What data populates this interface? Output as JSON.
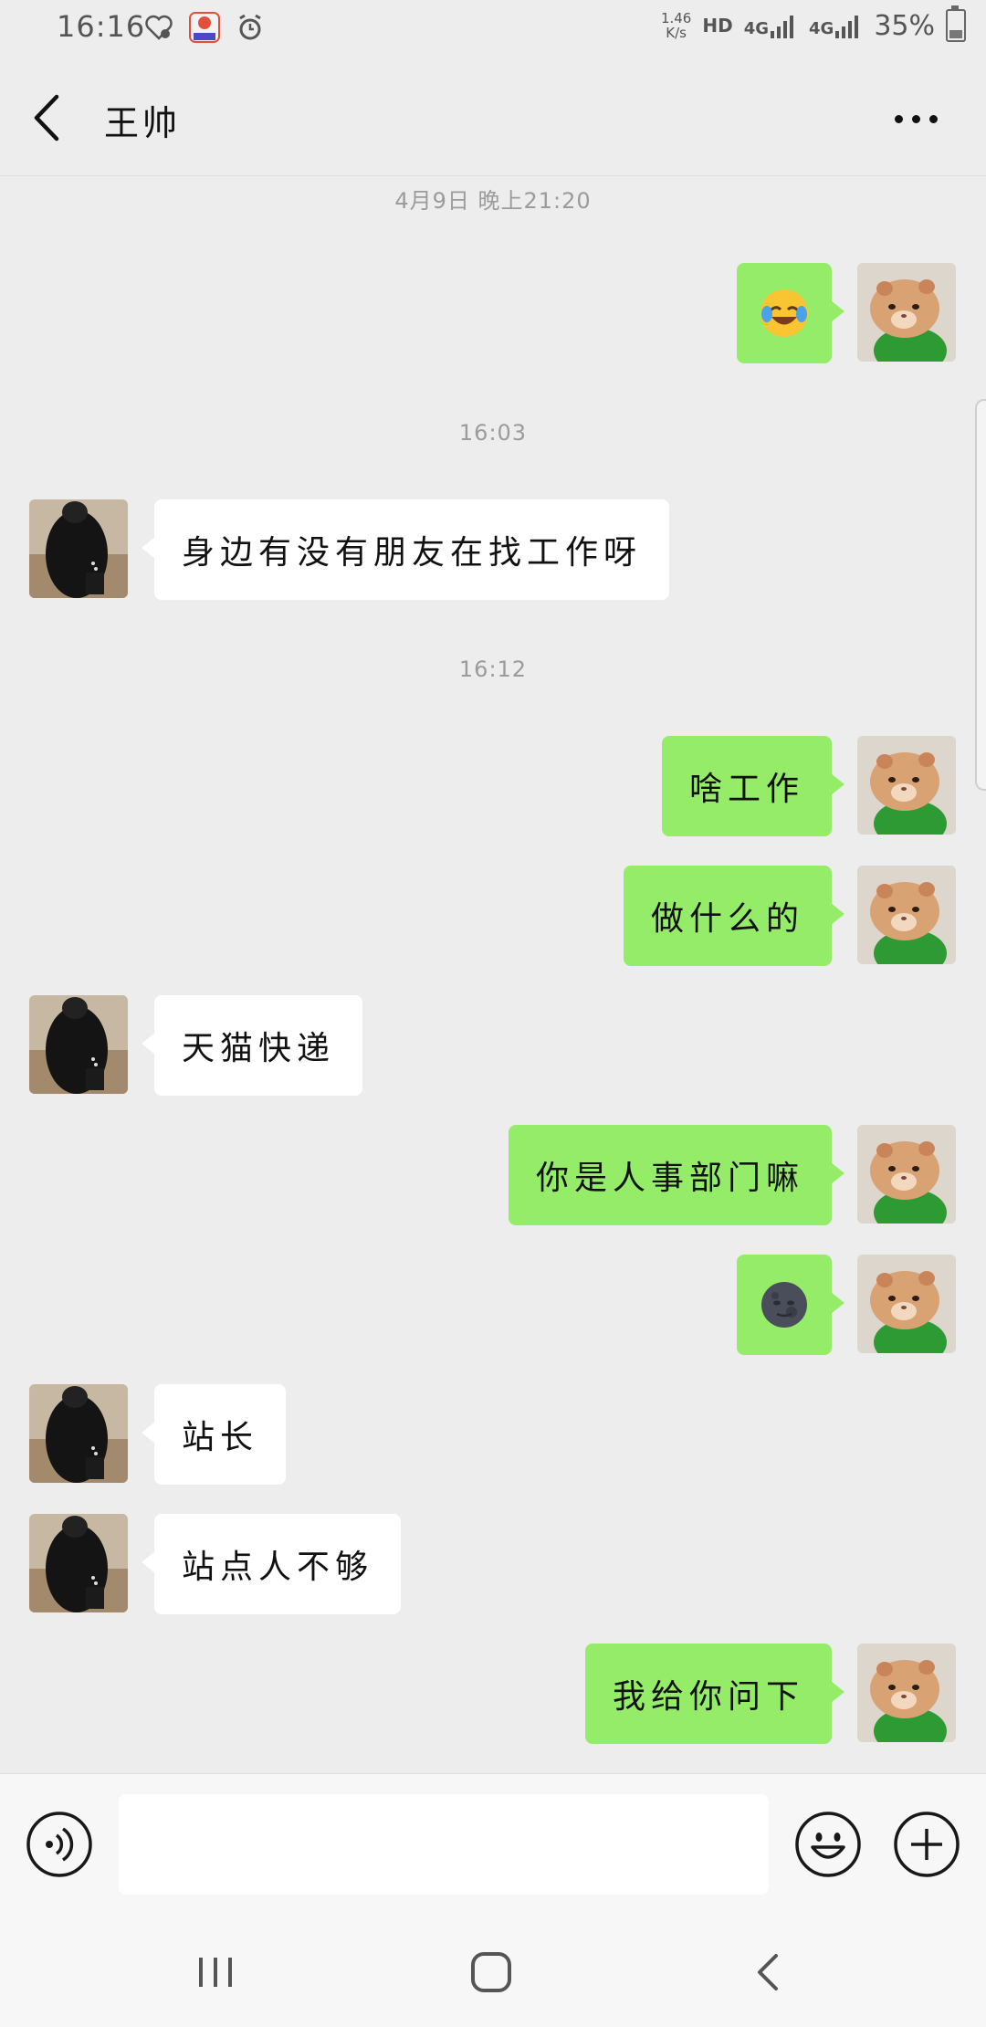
{
  "status_bar": {
    "time": "16:16",
    "net_speed_value": "1.46",
    "net_speed_unit": "K/s",
    "hd": "HD",
    "network_1": "4G",
    "network_2": "4G",
    "battery_percent": "35%",
    "battery_level": 0.35
  },
  "header": {
    "title": "王帅"
  },
  "chat": {
    "timestamps": [
      "4月9日 晚上21:20",
      "16:03",
      "16:12"
    ],
    "messages": [
      {
        "from": "me",
        "type": "emoji",
        "icon": "face-with-tears-of-joy-emoji"
      },
      {
        "from": "contact",
        "type": "text",
        "text": "身边有没有朋友在找工作呀"
      },
      {
        "from": "me",
        "type": "text",
        "text": "啥工作"
      },
      {
        "from": "me",
        "type": "text",
        "text": "做什么的"
      },
      {
        "from": "contact",
        "type": "text",
        "text": "天猫快递"
      },
      {
        "from": "me",
        "type": "text",
        "text": "你是人事部门嘛"
      },
      {
        "from": "me",
        "type": "emoji",
        "icon": "new-moon-face-emoji"
      },
      {
        "from": "contact",
        "type": "text",
        "text": "站长"
      },
      {
        "from": "contact",
        "type": "text",
        "text": "站点人不够"
      },
      {
        "from": "me",
        "type": "text",
        "text": "我给你问下"
      }
    ]
  },
  "input_bar": {
    "text_value": "",
    "icons": [
      "voice-icon",
      "emoji-icon",
      "plus-icon"
    ]
  },
  "nav_bar": {
    "icons": [
      "recent-apps-icon",
      "home-icon",
      "back-icon"
    ]
  },
  "colors": {
    "background": "#ededed",
    "outgoing_bubble": "#95ec69",
    "incoming_bubble": "#ffffff",
    "timestamp_text": "#9b9b9b"
  }
}
